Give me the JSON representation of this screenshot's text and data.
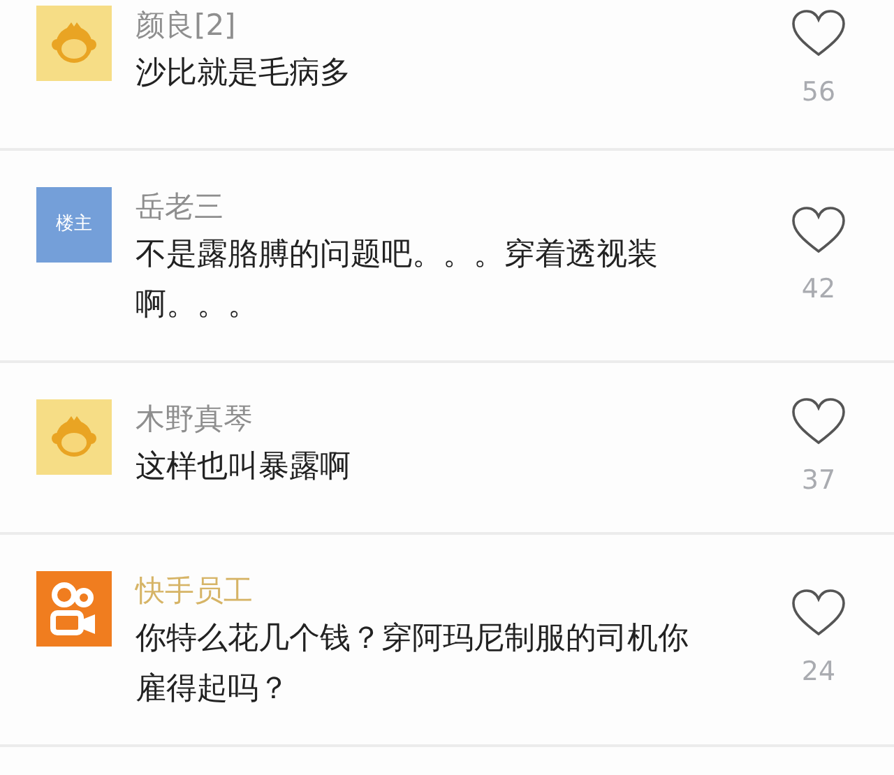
{
  "comments": [
    {
      "avatar": {
        "kind": "monkey"
      },
      "author": {
        "name": "颜良[2]",
        "color": "#8e8e8e"
      },
      "lines": [
        "沙比就是毛病多"
      ],
      "likes": "56",
      "liked": false
    },
    {
      "avatar": {
        "kind": "badge",
        "text": "楼主"
      },
      "author": {
        "name": "岳老三",
        "color": "#8e8e8e"
      },
      "lines": [
        "不是露胳膊的问题吧。。。穿着透视装",
        "啊。。。"
      ],
      "likes": "42",
      "liked": false
    },
    {
      "avatar": {
        "kind": "monkey"
      },
      "author": {
        "name": "木野真琴",
        "color": "#8e8e8e"
      },
      "lines": [
        "这样也叫暴露啊"
      ],
      "likes": "37",
      "liked": false
    },
    {
      "avatar": {
        "kind": "logo"
      },
      "author": {
        "name": "快手员工",
        "color": "#d6b466"
      },
      "lines": [
        "你特么花几个钱？穿阿玛尼制服的司机你",
        "雇得起吗？"
      ],
      "likes": "24",
      "liked": false
    }
  ]
}
